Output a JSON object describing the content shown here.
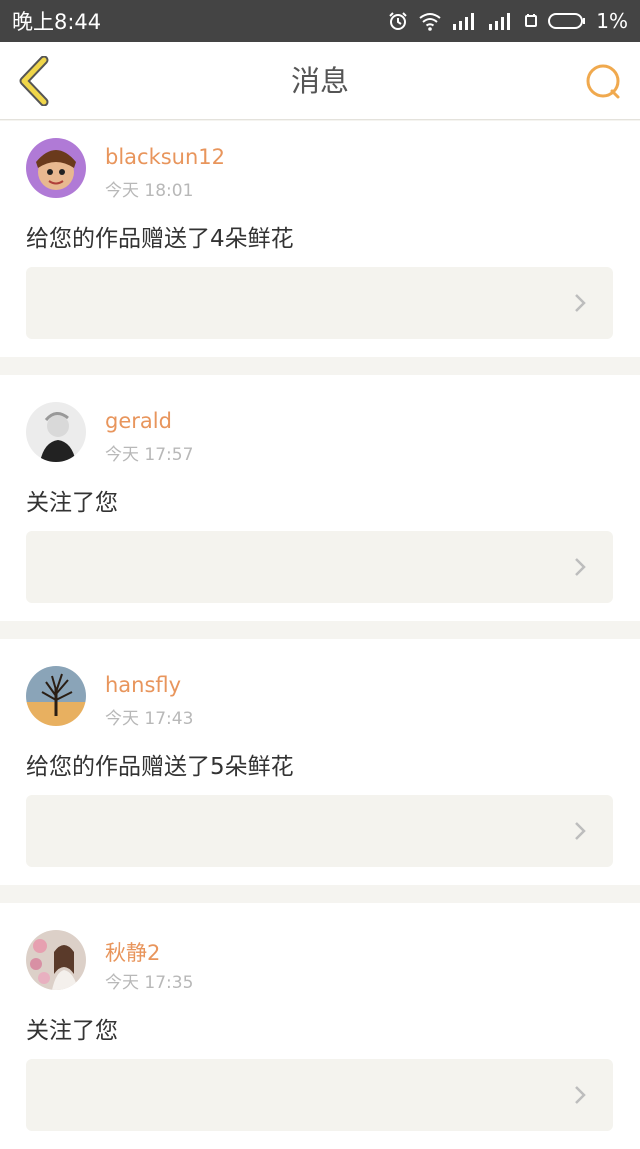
{
  "status_bar": {
    "time": "晚上8:44",
    "battery_percent": "1%",
    "icons": [
      "alarm-icon",
      "wifi-icon",
      "signal-icon",
      "signal-icon",
      "android-icon",
      "battery-icon"
    ]
  },
  "nav": {
    "title": "消息",
    "back_icon": "chevron-left-icon",
    "search_icon": "search-icon",
    "accent_color": "#f0a94e"
  },
  "messages": [
    {
      "username": "blacksun12",
      "time": "今天 18:01",
      "text": "给您的作品赠送了4朵鲜花",
      "avatar": "cartoon-avatar"
    },
    {
      "username": "gerald",
      "time": "今天 17:57",
      "text": "关注了您",
      "avatar": "portrait-avatar"
    },
    {
      "username": "hansfly",
      "time": "今天 17:43",
      "text": "给您的作品赠送了5朵鲜花",
      "avatar": "tree-avatar"
    },
    {
      "username": "秋静2",
      "time": "今天 17:35",
      "text": "关注了您",
      "avatar": "flower-girl-avatar"
    }
  ],
  "colors": {
    "username": "#e8955c",
    "status_bar_bg": "#444444",
    "page_bg": "#f5f4f0"
  }
}
